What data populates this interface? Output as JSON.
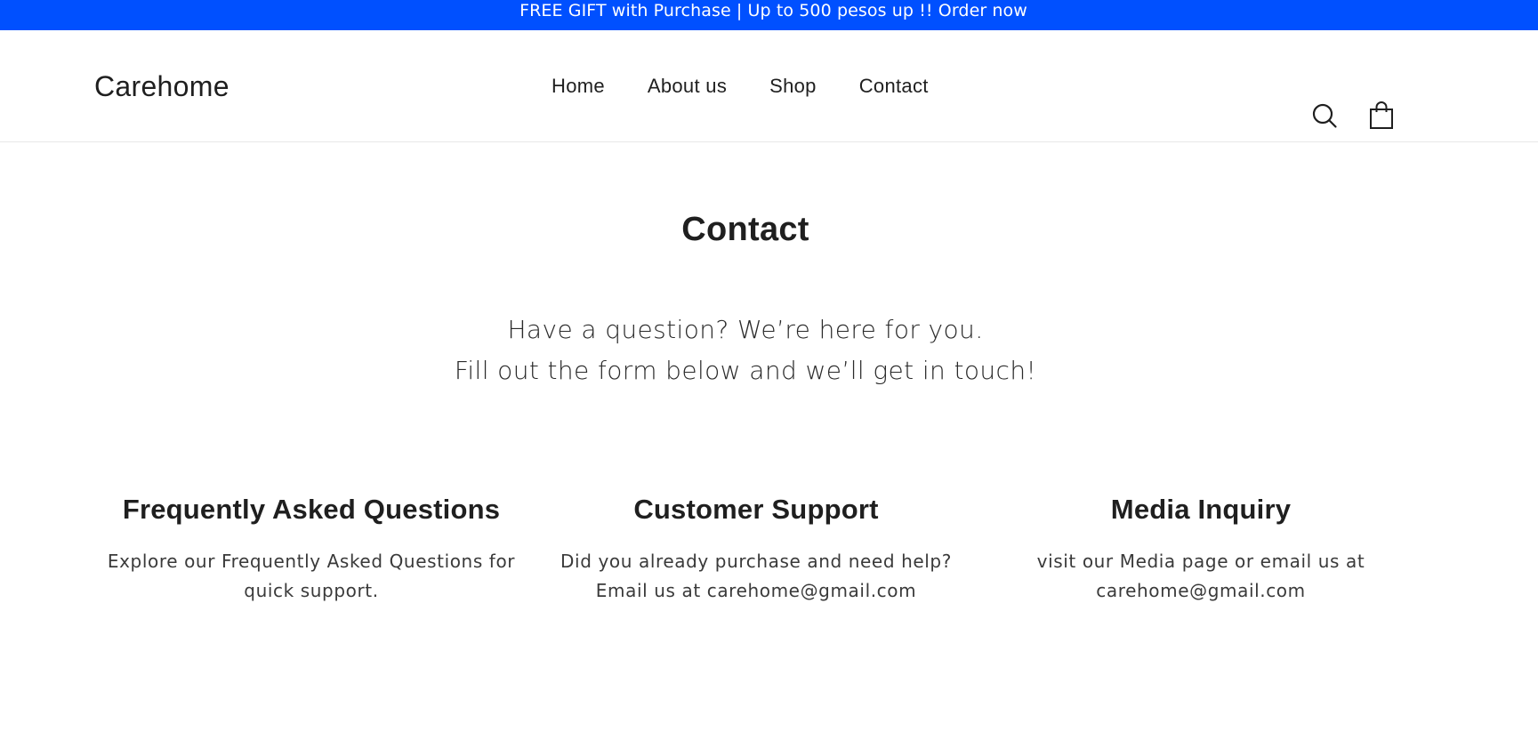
{
  "announcement": {
    "text": "FREE GIFT with Purchase | Up to 500 pesos up !! Order now"
  },
  "header": {
    "logo": "Carehome",
    "nav": [
      "Home",
      "About us",
      "Shop",
      "Contact"
    ],
    "icons": [
      "search-icon",
      "cart-icon"
    ]
  },
  "main": {
    "title": "Contact",
    "intro_line1": "Have a question? We’re here for you.",
    "intro_line2": "Fill out the form below and we’ll get in touch!"
  },
  "columns": [
    {
      "heading": "Frequently Asked Questions",
      "line1": "Explore our Frequently Asked Questions for",
      "line2": "quick support."
    },
    {
      "heading": "Customer Support",
      "line1": "Did you already purchase and need help?",
      "line2": "Email us at carehome@gmail.com"
    },
    {
      "heading": "Media Inquiry",
      "line1": "visit our Media page or email us at",
      "line2": "carehome@gmail.com"
    }
  ],
  "colors": {
    "announcement_bg": "#0050ff",
    "text": "#1f1f1f"
  }
}
